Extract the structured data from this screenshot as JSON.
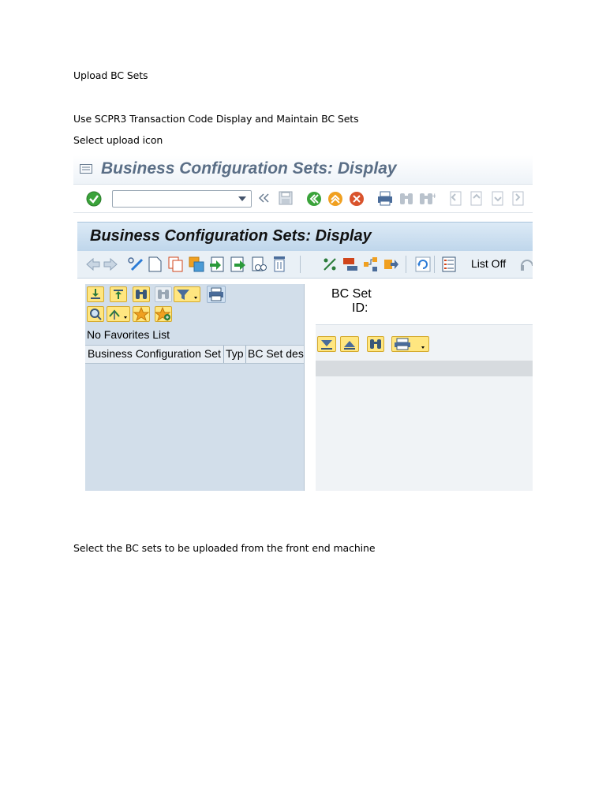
{
  "document": {
    "heading": "Upload BC Sets",
    "instruction_1": "Use SCPR3 Transaction Code  Display and Maintain BC Sets",
    "instruction_2": "Select upload icon",
    "instruction_3": "Select the BC sets to be uploaded from the front end machine"
  },
  "sap_window": {
    "window_title": "Business Configuration Sets: Display",
    "app_title": "Business Configuration Sets: Display",
    "command_field": {
      "value": ""
    },
    "toolbar": {
      "list_off_label": "List Off"
    },
    "left_pane": {
      "no_favorites_label": "No Favorites List",
      "columns": [
        "Business Configuration Set",
        "Typ",
        "BC Set desc"
      ]
    },
    "right_pane": {
      "bc_set_label": "BC Set",
      "id_label": "ID:"
    }
  },
  "colors": {
    "title_text": "#5a6e86",
    "app_title_bar": "#bfd6eb",
    "left_pane": "#d2deea",
    "button_yellow": "#ffe680"
  }
}
